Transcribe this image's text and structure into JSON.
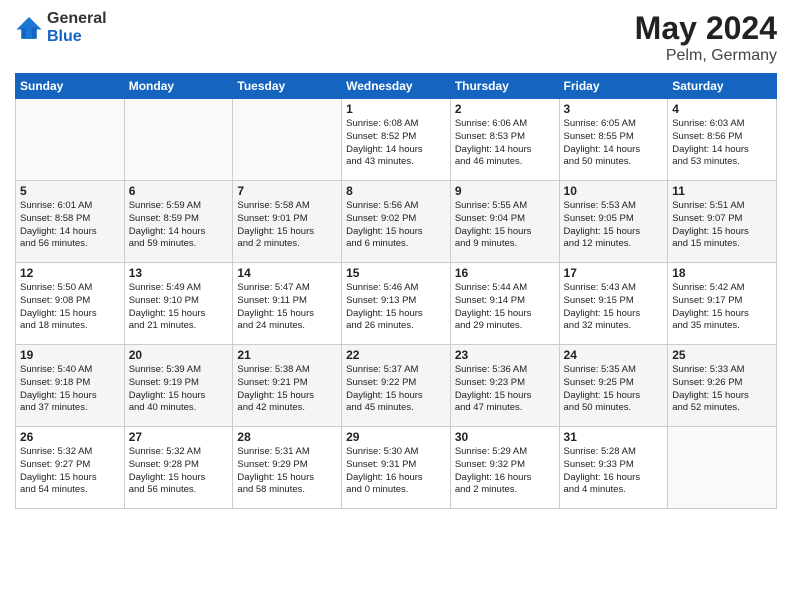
{
  "logo": {
    "general": "General",
    "blue": "Blue"
  },
  "title": {
    "month": "May 2024",
    "location": "Pelm, Germany"
  },
  "weekdays": [
    "Sunday",
    "Monday",
    "Tuesday",
    "Wednesday",
    "Thursday",
    "Friday",
    "Saturday"
  ],
  "weeks": [
    [
      {
        "day": "",
        "info": ""
      },
      {
        "day": "",
        "info": ""
      },
      {
        "day": "",
        "info": ""
      },
      {
        "day": "1",
        "info": "Sunrise: 6:08 AM\nSunset: 8:52 PM\nDaylight: 14 hours\nand 43 minutes."
      },
      {
        "day": "2",
        "info": "Sunrise: 6:06 AM\nSunset: 8:53 PM\nDaylight: 14 hours\nand 46 minutes."
      },
      {
        "day": "3",
        "info": "Sunrise: 6:05 AM\nSunset: 8:55 PM\nDaylight: 14 hours\nand 50 minutes."
      },
      {
        "day": "4",
        "info": "Sunrise: 6:03 AM\nSunset: 8:56 PM\nDaylight: 14 hours\nand 53 minutes."
      }
    ],
    [
      {
        "day": "5",
        "info": "Sunrise: 6:01 AM\nSunset: 8:58 PM\nDaylight: 14 hours\nand 56 minutes."
      },
      {
        "day": "6",
        "info": "Sunrise: 5:59 AM\nSunset: 8:59 PM\nDaylight: 14 hours\nand 59 minutes."
      },
      {
        "day": "7",
        "info": "Sunrise: 5:58 AM\nSunset: 9:01 PM\nDaylight: 15 hours\nand 2 minutes."
      },
      {
        "day": "8",
        "info": "Sunrise: 5:56 AM\nSunset: 9:02 PM\nDaylight: 15 hours\nand 6 minutes."
      },
      {
        "day": "9",
        "info": "Sunrise: 5:55 AM\nSunset: 9:04 PM\nDaylight: 15 hours\nand 9 minutes."
      },
      {
        "day": "10",
        "info": "Sunrise: 5:53 AM\nSunset: 9:05 PM\nDaylight: 15 hours\nand 12 minutes."
      },
      {
        "day": "11",
        "info": "Sunrise: 5:51 AM\nSunset: 9:07 PM\nDaylight: 15 hours\nand 15 minutes."
      }
    ],
    [
      {
        "day": "12",
        "info": "Sunrise: 5:50 AM\nSunset: 9:08 PM\nDaylight: 15 hours\nand 18 minutes."
      },
      {
        "day": "13",
        "info": "Sunrise: 5:49 AM\nSunset: 9:10 PM\nDaylight: 15 hours\nand 21 minutes."
      },
      {
        "day": "14",
        "info": "Sunrise: 5:47 AM\nSunset: 9:11 PM\nDaylight: 15 hours\nand 24 minutes."
      },
      {
        "day": "15",
        "info": "Sunrise: 5:46 AM\nSunset: 9:13 PM\nDaylight: 15 hours\nand 26 minutes."
      },
      {
        "day": "16",
        "info": "Sunrise: 5:44 AM\nSunset: 9:14 PM\nDaylight: 15 hours\nand 29 minutes."
      },
      {
        "day": "17",
        "info": "Sunrise: 5:43 AM\nSunset: 9:15 PM\nDaylight: 15 hours\nand 32 minutes."
      },
      {
        "day": "18",
        "info": "Sunrise: 5:42 AM\nSunset: 9:17 PM\nDaylight: 15 hours\nand 35 minutes."
      }
    ],
    [
      {
        "day": "19",
        "info": "Sunrise: 5:40 AM\nSunset: 9:18 PM\nDaylight: 15 hours\nand 37 minutes."
      },
      {
        "day": "20",
        "info": "Sunrise: 5:39 AM\nSunset: 9:19 PM\nDaylight: 15 hours\nand 40 minutes."
      },
      {
        "day": "21",
        "info": "Sunrise: 5:38 AM\nSunset: 9:21 PM\nDaylight: 15 hours\nand 42 minutes."
      },
      {
        "day": "22",
        "info": "Sunrise: 5:37 AM\nSunset: 9:22 PM\nDaylight: 15 hours\nand 45 minutes."
      },
      {
        "day": "23",
        "info": "Sunrise: 5:36 AM\nSunset: 9:23 PM\nDaylight: 15 hours\nand 47 minutes."
      },
      {
        "day": "24",
        "info": "Sunrise: 5:35 AM\nSunset: 9:25 PM\nDaylight: 15 hours\nand 50 minutes."
      },
      {
        "day": "25",
        "info": "Sunrise: 5:33 AM\nSunset: 9:26 PM\nDaylight: 15 hours\nand 52 minutes."
      }
    ],
    [
      {
        "day": "26",
        "info": "Sunrise: 5:32 AM\nSunset: 9:27 PM\nDaylight: 15 hours\nand 54 minutes."
      },
      {
        "day": "27",
        "info": "Sunrise: 5:32 AM\nSunset: 9:28 PM\nDaylight: 15 hours\nand 56 minutes."
      },
      {
        "day": "28",
        "info": "Sunrise: 5:31 AM\nSunset: 9:29 PM\nDaylight: 15 hours\nand 58 minutes."
      },
      {
        "day": "29",
        "info": "Sunrise: 5:30 AM\nSunset: 9:31 PM\nDaylight: 16 hours\nand 0 minutes."
      },
      {
        "day": "30",
        "info": "Sunrise: 5:29 AM\nSunset: 9:32 PM\nDaylight: 16 hours\nand 2 minutes."
      },
      {
        "day": "31",
        "info": "Sunrise: 5:28 AM\nSunset: 9:33 PM\nDaylight: 16 hours\nand 4 minutes."
      },
      {
        "day": "",
        "info": ""
      }
    ]
  ]
}
